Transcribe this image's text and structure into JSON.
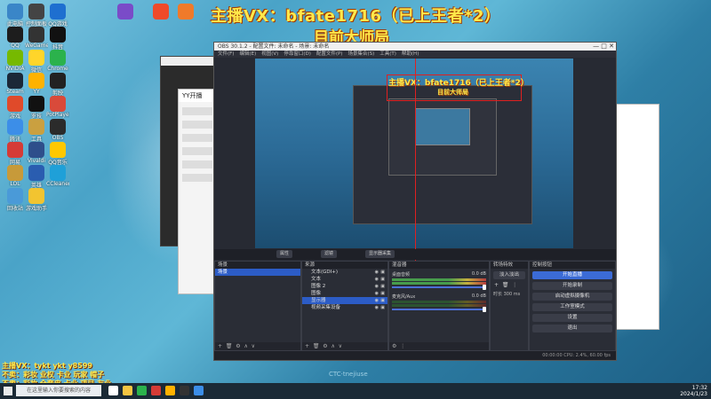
{
  "overlay": {
    "title": "主播VX：bfate1716（已上王者*2）",
    "subtitle": "目前大师局"
  },
  "bottom_lines": [
    "主播VX：tykt ykt y8599",
    "不卖：彩妆 业权 卡业 玩家 帽子",
    "不卖：彩妆 全套皮 卡业 项目 友业"
  ],
  "desktop_icons": [
    {
      "label": "此电脑",
      "color": "#3a86c8"
    },
    {
      "label": "QQ",
      "color": "#1d1d1d"
    },
    {
      "label": "NVIDIA",
      "color": "#76b900"
    },
    {
      "label": "Steam",
      "color": "#1b2838"
    },
    {
      "label": "游戏",
      "color": "#e04a2a"
    },
    {
      "label": "腾讯",
      "color": "#3c8ee8"
    },
    {
      "label": "网易",
      "color": "#d53b36"
    },
    {
      "label": "LOL",
      "color": "#c79a3a"
    },
    {
      "label": "回收站",
      "color": "#4a9ad8"
    },
    {
      "label": "控制面板",
      "color": "#444"
    },
    {
      "label": "WeGame",
      "color": "#333"
    },
    {
      "label": "微信",
      "color": "#ffd52a"
    },
    {
      "label": "YY",
      "color": "#ffb200"
    },
    {
      "label": "罗技",
      "color": "#111"
    },
    {
      "label": "工具",
      "color": "#caa040"
    },
    {
      "label": "Vivaldi",
      "color": "#2e4f8b"
    },
    {
      "label": "英雄",
      "color": "#2a5db0"
    },
    {
      "label": "游戏助手",
      "color": "#f2c430"
    },
    {
      "label": "QQ游戏",
      "color": "#1e6fd0"
    },
    {
      "label": "抖音",
      "color": "#111"
    },
    {
      "label": "Chrome",
      "color": "#2bb24c"
    },
    {
      "label": "剪映",
      "color": "#222"
    },
    {
      "label": "PotPlayer",
      "color": "#d94a3a"
    },
    {
      "label": "OBS",
      "color": "#2b2b2b"
    },
    {
      "label": "QQ音乐",
      "color": "#ffc800"
    },
    {
      "label": "CCleaner",
      "color": "#1fa0d8"
    }
  ],
  "obs": {
    "title": "OBS 30.1.2 - 配置文件: 未命名 - 场景: 未命名",
    "menu": [
      "文件(F)",
      "编辑(E)",
      "视图(V)",
      "停靠窗口(D)",
      "配置文件(P)",
      "场景集合(S)",
      "工具(T)",
      "帮助(H)"
    ],
    "toolbar": [
      "属性",
      "滤镜",
      "显示器采集"
    ],
    "scenes": {
      "header": "场景",
      "items": [
        "场景"
      ],
      "selected": 0
    },
    "sources": {
      "header": "来源",
      "items": [
        "文本(GDI+)",
        "文本",
        "图像 2",
        "图像",
        "显示器",
        "视频采集设备"
      ],
      "selected": 4
    },
    "mixer": {
      "header": "混音器",
      "channels": [
        {
          "name": "桌面音频",
          "db": "0.0 dB",
          "active": true
        },
        {
          "name": "麦克风/Aux",
          "db": "0.0 dB",
          "active": false
        }
      ]
    },
    "transitions": {
      "header": "转场特效",
      "type": "淡入淡出",
      "duration_label": "时长",
      "duration": "300 ms"
    },
    "controls": {
      "header": "控制按钮",
      "buttons": [
        "开始直播",
        "开始录制",
        "启动虚拟摄像机",
        "工作室模式",
        "设置",
        "退出"
      ]
    },
    "status": "00:00:00  CPU: 2.4%, 60.00 fps",
    "preview_label": "主播VX：bfate1716（已上王者*2）",
    "preview_sub": "目前大师局"
  },
  "yy_window": {
    "title": "YY开播"
  },
  "watermark": "CTC·tnejiuse",
  "taskbar": {
    "search_placeholder": "在这里输入你要搜索的内容",
    "time": "17:32",
    "date": "2024/1/23"
  }
}
